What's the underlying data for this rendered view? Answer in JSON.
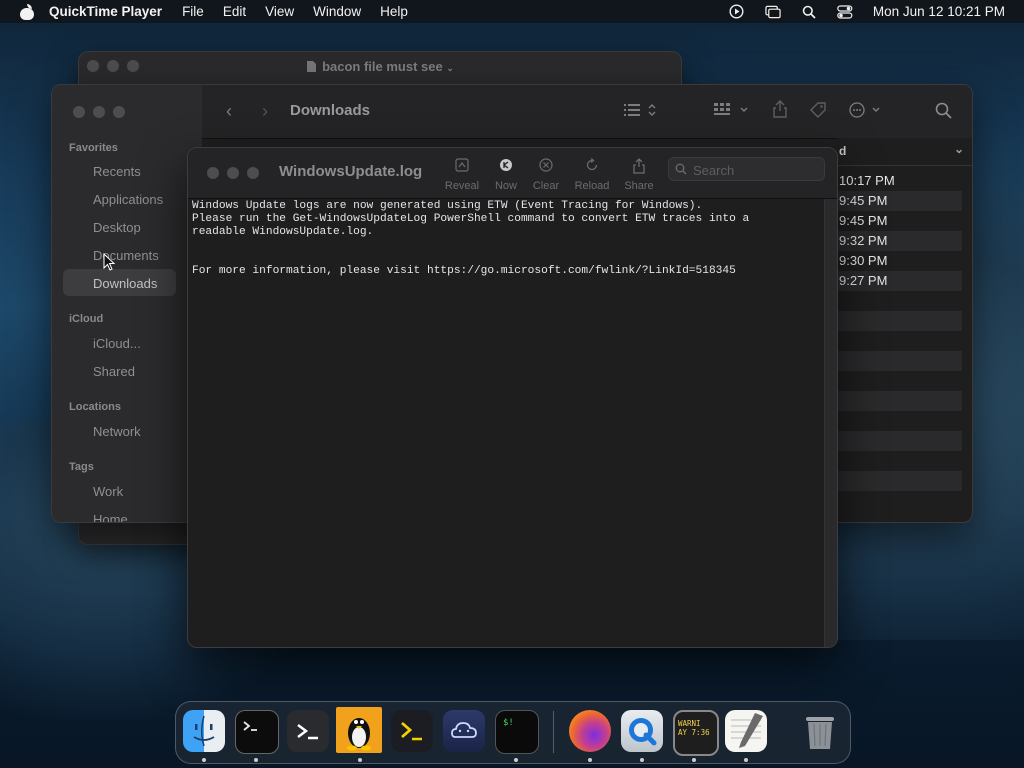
{
  "menubar": {
    "app_name": "QuickTime Player",
    "items": [
      "File",
      "Edit",
      "View",
      "Window",
      "Help"
    ],
    "clock": "Mon Jun 12  10:21 PM"
  },
  "back_window": {
    "title": "bacon file must see"
  },
  "finder": {
    "title": "Downloads",
    "sidebar": {
      "favorites_heading": "Favorites",
      "favorites": [
        "Recents",
        "Applications",
        "Desktop",
        "Documents",
        "Downloads"
      ],
      "icloud_heading": "iCloud",
      "icloud": [
        "iCloud...",
        "Shared"
      ],
      "locations_heading": "Locations",
      "locations": [
        "Network"
      ],
      "tags_heading": "Tags",
      "tags": [
        "Work",
        "Home"
      ]
    },
    "column_header": "d",
    "times": [
      "10:17 PM",
      "9:45 PM",
      "9:45 PM",
      "9:32 PM",
      "9:30 PM",
      "9:27 PM"
    ]
  },
  "console": {
    "title": "WindowsUpdate.log",
    "toolbar": {
      "reveal": "Reveal",
      "now": "Now",
      "clear": "Clear",
      "reload": "Reload",
      "share": "Share"
    },
    "search_placeholder": "Search",
    "log_lines": [
      "Windows Update logs are now generated using ETW (Event Tracing for Windows).",
      "Please run the Get-WindowsUpdateLog PowerShell command to convert ETW traces into a",
      "readable WindowsUpdate.log.",
      "",
      "",
      "For more information, please visit https://go.microsoft.com/fwlink/?LinkId=518345"
    ]
  },
  "dock": {
    "apps": [
      "finder-icon",
      "terminal-icon",
      "powershell-icon",
      "linux-tux-icon",
      "terminal-prompt-icon",
      "cloud-app-icon",
      "terminal-green-icon",
      "firefox-icon",
      "quicktime-icon",
      "console-icon",
      "textedit-icon",
      "trash-icon"
    ],
    "console_icon_text": "WARNI\nAY 7:36"
  },
  "colors": {
    "accent": "#0a84ff",
    "window_bg": "#1e1e1f"
  }
}
